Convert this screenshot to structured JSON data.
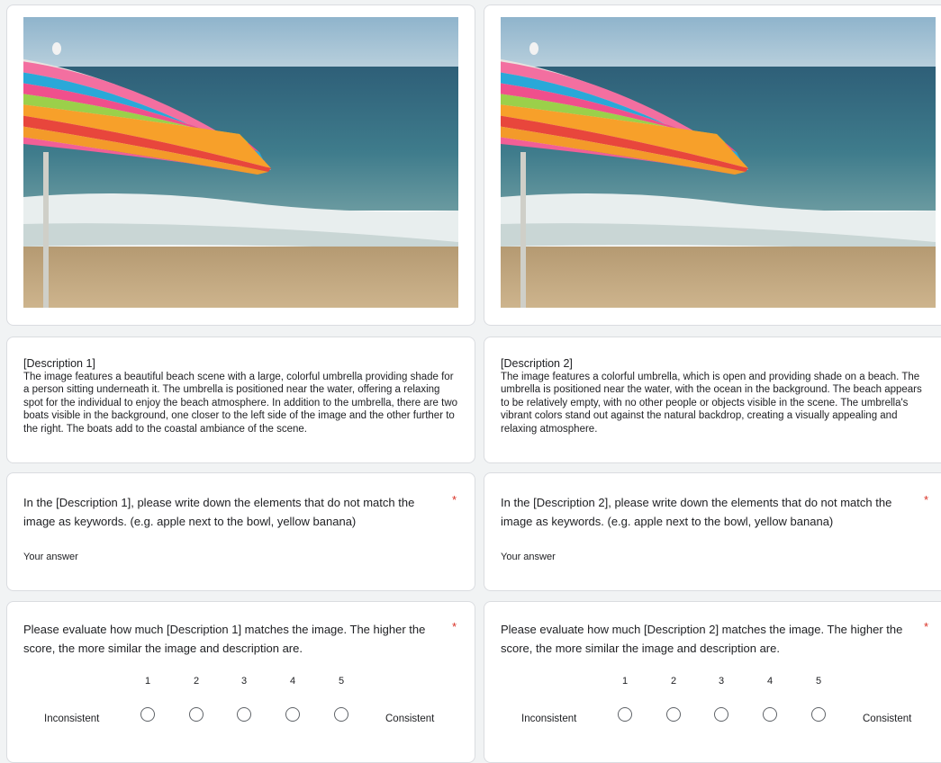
{
  "form": {
    "descriptions": [
      {
        "header": "[Description 1]",
        "body": "The image features a beautiful beach scene with a large, colorful umbrella providing shade for a person sitting underneath it. The umbrella is positioned near the water, offering a relaxing spot for the individual to enjoy the beach atmosphere. In addition to the umbrella, there are two boats visible in the background, one closer to the left side of the image and the other further to the right. The boats add to the coastal ambiance of the scene."
      },
      {
        "header": "[Description 2]",
        "body": "The image features a colorful umbrella, which is open and providing shade on a beach. The umbrella is positioned near the water, with the ocean in the background. The beach appears to be relatively empty, with no other people or objects visible in the scene. The umbrella's vibrant colors stand out against the natural backdrop, creating a visually appealing and relaxing atmosphere."
      }
    ],
    "questions": [
      {
        "text": "In the [Description 1], please write down the elements that do not match the image as keywords. (e.g. apple next to the bowl, yellow banana)",
        "required_mark": "*",
        "answer_placeholder": "Your answer"
      },
      {
        "text": "In the [Description 2], please write down the elements that do not match the image as keywords. (e.g. apple next to the bowl, yellow banana)",
        "required_mark": "*",
        "answer_placeholder": "Your answer"
      }
    ],
    "ratings": [
      {
        "text": "Please evaluate how much [Description 1] matches the image. The higher the score, the more similar the image and description are.",
        "required_mark": "*",
        "scale": [
          "1",
          "2",
          "3",
          "4",
          "5"
        ],
        "min_label": "Inconsistent",
        "max_label": "Consistent"
      },
      {
        "text": "Please evaluate how much [Description 2] matches the image. The higher the score, the more similar the image and description are.",
        "required_mark": "*",
        "scale": [
          "1",
          "2",
          "3",
          "4",
          "5"
        ],
        "min_label": "Inconsistent",
        "max_label": "Consistent"
      }
    ]
  },
  "colors": {
    "background": "#f1f3f4",
    "card": "#ffffff",
    "border": "#dadce0",
    "required": "#d93025"
  }
}
